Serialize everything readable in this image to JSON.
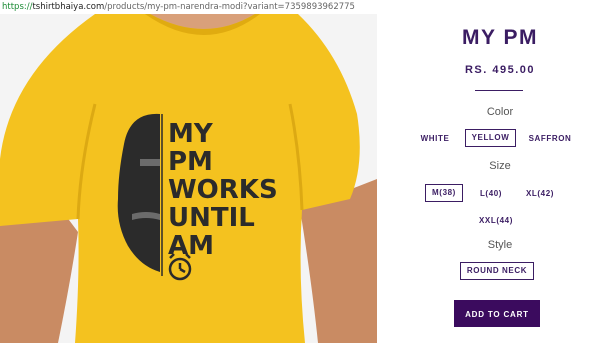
{
  "browser": {
    "url_scheme": "https://",
    "url_domain": "tshirtbhaiya.com",
    "url_path": "/products/my-pm-narendra-modi?variant=7359893962775"
  },
  "product": {
    "title": "MY PM",
    "price": "RS. 495.00",
    "image": {
      "print_lines": [
        "MY",
        "PM",
        "WORKS",
        "UNTIL",
        "AM"
      ],
      "shirt_color": "#f4c21f",
      "print_color": "#2b2b2b"
    },
    "color_option": {
      "label": "Color",
      "values": [
        "WHITE",
        "YELLOW",
        "SAFFRON"
      ],
      "selected": "YELLOW"
    },
    "size_option": {
      "label": "Size",
      "values": [
        "M(38)",
        "L(40)",
        "XL(42)",
        "XXL(44)"
      ],
      "selected": "M(38)"
    },
    "style_option": {
      "label": "Style",
      "values": [
        "ROUND NECK"
      ],
      "selected": "ROUND NECK"
    },
    "add_to_cart_label": "ADD TO CART"
  },
  "theme": {
    "accent": "#3b1d63",
    "button_bg": "#3b0b5e"
  }
}
